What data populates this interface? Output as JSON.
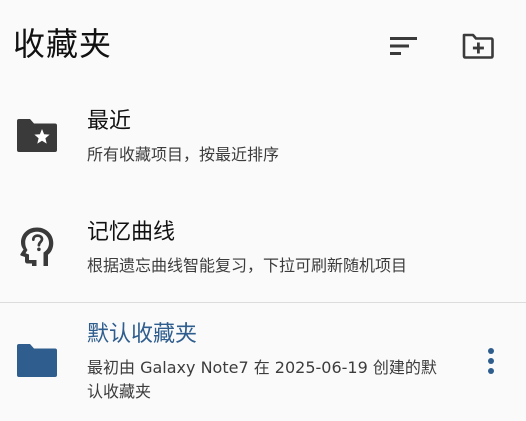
{
  "header": {
    "title": "收藏夹",
    "sort_icon": "sort-icon",
    "add_folder_icon": "create-new-folder-icon"
  },
  "items": [
    {
      "icon": "folder-star-icon",
      "title": "最近",
      "description": "所有收藏项目，按最近排序"
    },
    {
      "icon": "psychology-head-icon",
      "title": "记忆曲线",
      "description": "根据遗忘曲线智能复习，下拉可刷新随机项目"
    },
    {
      "icon": "folder-icon",
      "title": "默认收藏夹",
      "description": "最初由 Galaxy Note7 在 2025-06-19 创建的默认收藏夹",
      "more_icon": "more-vert-icon"
    }
  ],
  "colors": {
    "background": "#fafafa",
    "text": "#111111",
    "secondary_text": "#3c3c3c",
    "accent": "#2f5d8e",
    "icon_dark": "#3a3a3a"
  }
}
